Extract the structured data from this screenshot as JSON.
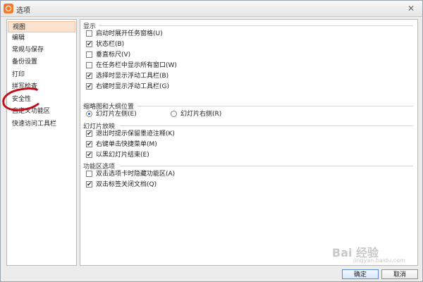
{
  "window": {
    "title": "选项"
  },
  "sidebar": {
    "items": [
      {
        "label": "视图",
        "selected": true
      },
      {
        "label": "编辑"
      },
      {
        "label": "常规与保存"
      },
      {
        "label": "备份设置"
      },
      {
        "label": "打印"
      },
      {
        "label": "拼写检查"
      },
      {
        "label": "安全性"
      },
      {
        "label": "自定义功能区"
      },
      {
        "label": "快速访问工具栏"
      }
    ]
  },
  "display": {
    "title": "显示",
    "options": [
      {
        "label": "启动时展开任务窗格(U)",
        "checked": false
      },
      {
        "label": "状态栏(B)",
        "checked": true
      },
      {
        "label": "垂直标尺(V)",
        "checked": false
      },
      {
        "label": "在任务栏中显示所有窗口(W)",
        "checked": false
      },
      {
        "label": "选择时显示浮动工具栏(B)",
        "checked": true
      },
      {
        "label": "右键时显示浮动工具栏(G)",
        "checked": true
      }
    ]
  },
  "thumbnail": {
    "title": "缩略图和大纲位置",
    "left_label": "幻灯片左侧(E)",
    "right_label": "幻灯片右侧(R)",
    "selected": "left"
  },
  "slideshow": {
    "title": "幻灯片放映",
    "options": [
      {
        "label": "退出时提示保留墨迹注释(K)",
        "checked": true
      },
      {
        "label": "右键单击快捷菜单(M)",
        "checked": true
      },
      {
        "label": "以黑幻灯片结束(E)",
        "checked": true
      }
    ]
  },
  "ribbon": {
    "title": "功能区选项",
    "options": [
      {
        "label": "双击选项卡时隐藏功能区(A)",
        "checked": false
      },
      {
        "label": "双击标签关闭文档(Q)",
        "checked": true
      }
    ]
  },
  "buttons": {
    "ok": "确定",
    "cancel": "取消"
  },
  "watermark": {
    "main": "Bai 经验",
    "sub": "jingyan.baidu.com"
  }
}
